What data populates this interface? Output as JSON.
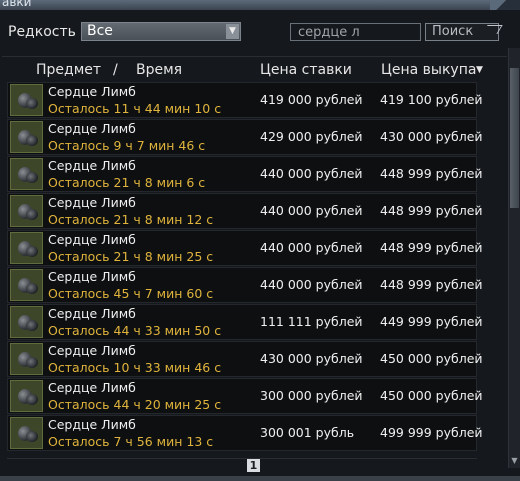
{
  "window": {
    "title_fragment": "авки"
  },
  "filter": {
    "rarity_label": "Редкость",
    "rarity_value": "Все",
    "search_value": "сердце л",
    "search_button": "Поиск"
  },
  "columns": {
    "item": "Предмет",
    "separator": "/",
    "time": "Время",
    "bid": "Цена ставки",
    "buyout": "Цена выкупа",
    "sort_indicator": "▼"
  },
  "rows": [
    {
      "name": "Сердце Лимб",
      "time_left": "Осталось 11 ч 44 мин 10 с",
      "bid": "419 000 рублей",
      "buyout": "419 100 рублей"
    },
    {
      "name": "Сердце Лимб",
      "time_left": "Осталось 9 ч 7 мин 46 с",
      "bid": "429 000 рублей",
      "buyout": "430 000 рублей"
    },
    {
      "name": "Сердце Лимб",
      "time_left": "Осталось 21 ч 8 мин 6 с",
      "bid": "440 000 рублей",
      "buyout": "448 999 рублей"
    },
    {
      "name": "Сердце Лимб",
      "time_left": "Осталось 21 ч 8 мин 12 с",
      "bid": "440 000 рублей",
      "buyout": "448 999 рублей"
    },
    {
      "name": "Сердце Лимб",
      "time_left": "Осталось 21 ч 8 мин 25 с",
      "bid": "440 000 рублей",
      "buyout": "448 999 рублей"
    },
    {
      "name": "Сердце Лимб",
      "time_left": "Осталось 45 ч 7 мин 60 с",
      "bid": "440 000 рублей",
      "buyout": "448 999 рублей"
    },
    {
      "name": "Сердце Лимб",
      "time_left": "Осталось 44 ч 33 мин 50 с",
      "bid": "111 111 рублей",
      "buyout": "449 999 рублей"
    },
    {
      "name": "Сердце Лимб",
      "time_left": "Осталось 10 ч 33 мин 46 с",
      "bid": "430 000 рублей",
      "buyout": "450 000 рублей"
    },
    {
      "name": "Сердце Лимб",
      "time_left": "Осталось 44 ч 20 мин 25 с",
      "bid": "300 000 рублей",
      "buyout": "450 000 рублей"
    },
    {
      "name": "Сердце Лимб",
      "time_left": "Осталось 7 ч 56 мин 13 с",
      "bid": "300 001 рубль",
      "buyout": "499 999 рублей"
    }
  ],
  "pager": {
    "current_page": "1"
  },
  "colors": {
    "time_text": "#e0b43c",
    "background": "#15181c"
  }
}
